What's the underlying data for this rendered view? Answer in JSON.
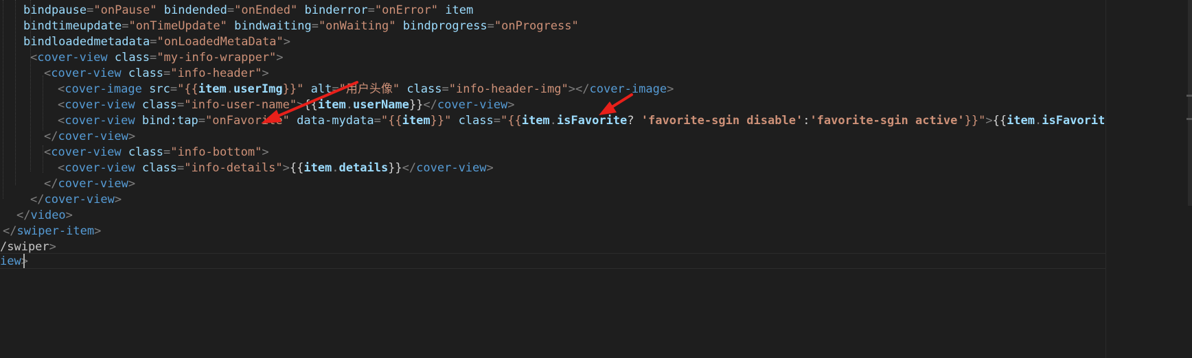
{
  "editor": {
    "lines": [
      {
        "indent": "  ",
        "segments": [
          {
            "cls": "a",
            "key": "l1a"
          },
          {
            "cls": "t",
            "key": "eq"
          },
          {
            "cls": "s",
            "key": "l1b"
          },
          {
            "cls": "txt",
            "key": "sp"
          },
          {
            "cls": "a",
            "key": "l1c"
          },
          {
            "cls": "t",
            "key": "eq"
          },
          {
            "cls": "s",
            "key": "l1d"
          },
          {
            "cls": "txt",
            "key": "sp"
          },
          {
            "cls": "a",
            "key": "l1e"
          },
          {
            "cls": "t",
            "key": "eq"
          },
          {
            "cls": "s",
            "key": "l1f"
          },
          {
            "cls": "txt",
            "key": "sp"
          },
          {
            "cls": "a",
            "key": "l1g"
          }
        ]
      }
    ],
    "text": {
      "eq": "=",
      "sp": " ",
      "l1a": "bindpause",
      "l1b": "\"onPause\"",
      "l1c": "bindended",
      "l1d": "\"onEnded\"",
      "l1e": "binderror",
      "l1f": "\"onError\"",
      "l1g": "item",
      "l2a": "bindtimeupdate",
      "l2b": "\"onTimeUpdate\"",
      "l2c": "bindwaiting",
      "l2d": "\"onWaiting\"",
      "l2e": "bindprogress",
      "l2f": "\"onProgress\"",
      "l3a": "bindloadedmetadata",
      "l3b": "\"onLoadedMetaData\"",
      "lt": "<",
      "gt": ">",
      "lts": "</",
      "cover_view": "cover-view",
      "cover_image": "cover-image",
      "class": "class",
      "src": "src",
      "alt": "alt",
      "my_info_wrapper": "\"my-info-wrapper\"",
      "info_header": "\"info-header\"",
      "user_img": "\"{{item.userImg}}\"",
      "user_img_pre": "\"{{",
      "user_img_item": "item",
      "dot": ".",
      "user_img_key": "userImg",
      "user_img_post": "}}\"",
      "alt_val": "\"用户头像\"",
      "info_header_img": "\"info-header-img\"",
      "info_user_name": "\"info-user-name\"",
      "mus_open": "{{",
      "mus_close": "}}",
      "item": "item",
      "userName": "userName",
      "bind_tap": "bind:tap",
      "on_favorite": "\"onFavorite\"",
      "data_mydata": "data-mydata",
      "mydata_pre": "\"{{",
      "mydata_post": "}}\"",
      "class_pre": "\"{{",
      "isFavorite": "isFavorite",
      "q": "?",
      "fav_disable": "'favorite-sgin disable'",
      "colon": ":",
      "fav_active": "'favorite-sgin active'",
      "class_post": "}}\"",
      "tail": "{{",
      "info_bottom": "\"info-bottom\"",
      "info_details": "\"info-details\"",
      "details": "details",
      "video": "video",
      "swiper_item": "swiper-item",
      "swiper_frag": "/swiper",
      "view_frag": "iew"
    }
  },
  "colors": {
    "background": "#1e1e1e",
    "arrow": "#e8201a"
  }
}
